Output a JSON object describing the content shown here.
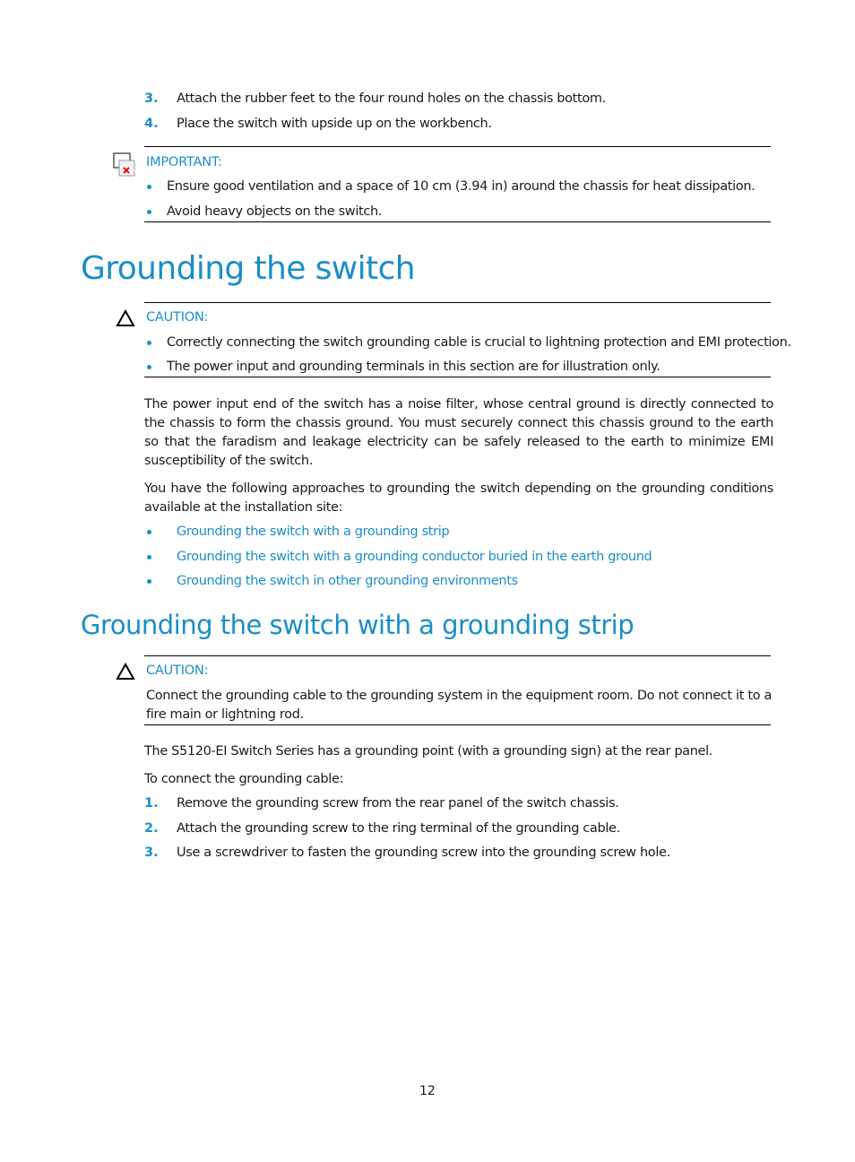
{
  "top_steps": [
    {
      "num": "3.",
      "text": "Attach the rubber feet to the four round holes on the chassis bottom."
    },
    {
      "num": "4.",
      "text": "Place the switch with upside up on the workbench."
    }
  ],
  "important_box": {
    "icon": "broken-image-icon",
    "label": "IMPORTANT:",
    "items": [
      "Ensure good ventilation and a space of 10 cm (3.94 in) around the chassis for heat dissipation.",
      "Avoid heavy objects on the switch."
    ]
  },
  "section1": {
    "title": "Grounding the switch",
    "caution": {
      "icon": "warning-triangle-icon",
      "label": "CAUTION:",
      "items": [
        "Correctly connecting the switch grounding cable is crucial to lightning protection and EMI protection.",
        "The power input and grounding terminals in this section are for illustration only."
      ]
    },
    "paragraphs": [
      "The power input end of the switch has a noise filter, whose central ground is directly connected to the chassis to form the chassis ground. You must securely connect this chassis ground to the earth so that the faradism and leakage electricity can be safely released to the earth to minimize EMI susceptibility of the switch.",
      "You have the following approaches to grounding the switch depending on the grounding conditions available at the installation site:"
    ],
    "links": [
      "Grounding the switch with a grounding strip",
      "Grounding the switch with a grounding conductor buried in the earth ground",
      "Grounding the switch in other grounding environments"
    ]
  },
  "section2": {
    "title": "Grounding the switch with a grounding strip",
    "caution": {
      "icon": "warning-triangle-icon",
      "label": "CAUTION:",
      "text": "Connect the grounding cable to the grounding system in the equipment room. Do not connect it to a fire main or lightning rod."
    },
    "paragraphs": [
      "The S5120-EI Switch Series has a grounding point (with a grounding sign) at the rear panel.",
      "To connect the grounding cable:"
    ],
    "steps": [
      {
        "num": "1.",
        "text": "Remove the grounding screw from the rear panel of the switch chassis."
      },
      {
        "num": "2.",
        "text": "Attach the grounding screw to the ring terminal of the grounding cable."
      },
      {
        "num": "3.",
        "text": "Use a screwdriver to fasten the grounding screw into the grounding screw hole."
      }
    ]
  },
  "footer": {
    "page_number": "12"
  }
}
